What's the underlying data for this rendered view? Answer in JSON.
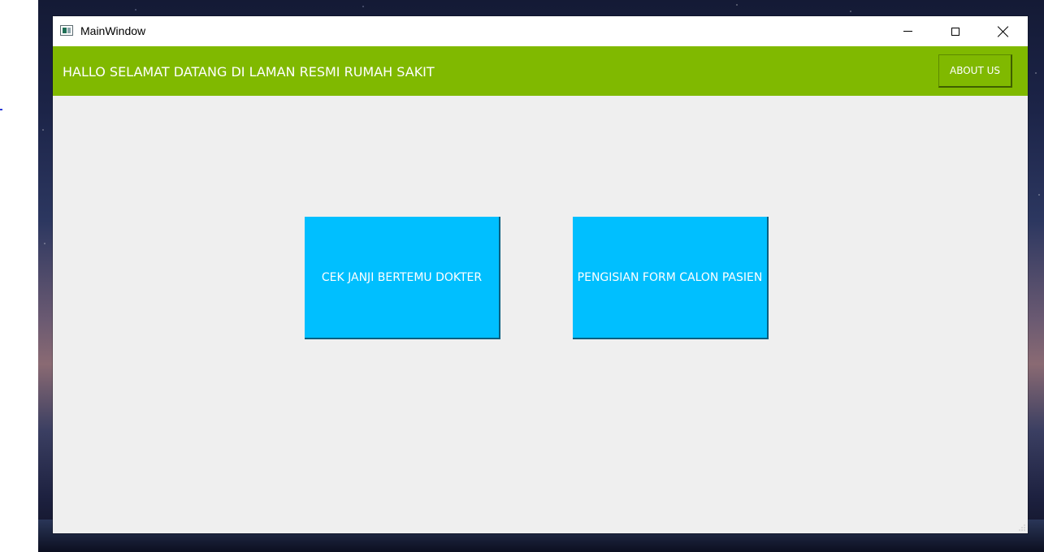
{
  "window": {
    "title": "MainWindow",
    "icon": "app-window-icon",
    "controls": [
      "minimize-icon",
      "maximize-icon",
      "close-icon"
    ]
  },
  "header": {
    "title": "HALLO SELAMAT DATANG DI LAMAN RESMI RUMAH SAKIT",
    "about_label": "ABOUT US",
    "background_color": "#80b900"
  },
  "main": {
    "buttons": [
      {
        "label": "CEK JANJI BERTEMU DOKTER"
      },
      {
        "label": "PENGISIAN FORM CALON PASIEN"
      }
    ],
    "button_color": "#00bfff",
    "background_color": "#efefef"
  }
}
